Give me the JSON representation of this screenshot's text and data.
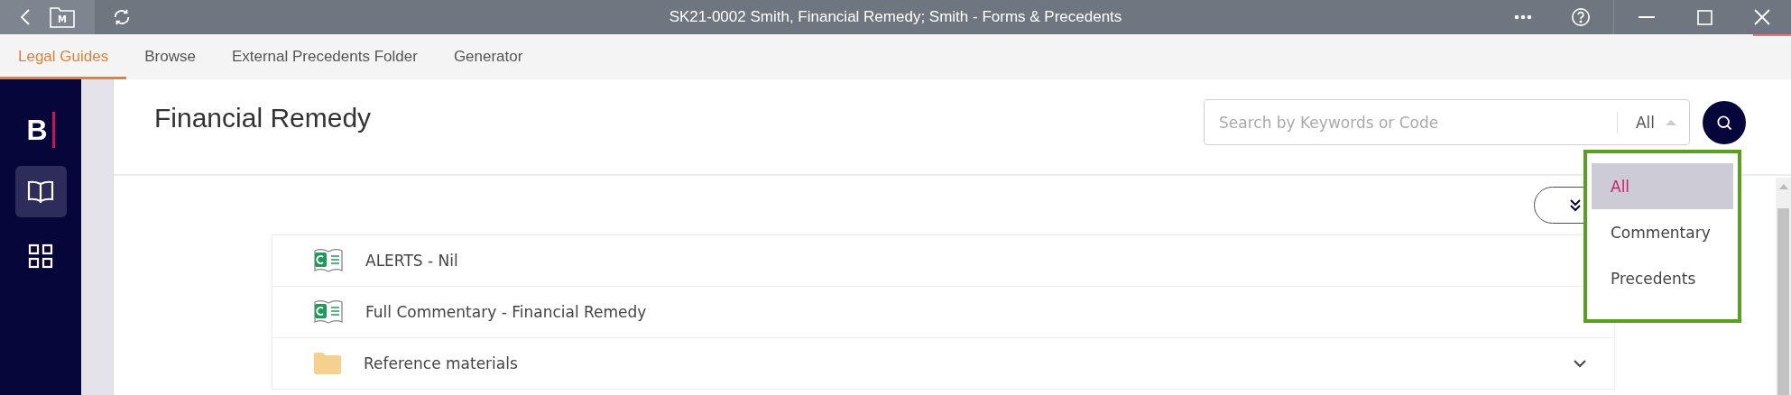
{
  "window": {
    "title": "SK21-0002 Smith, Financial Remedy; Smith - Forms & Precedents",
    "folder_badge": "M"
  },
  "tabs": [
    {
      "label": "Legal Guides",
      "selected": true
    },
    {
      "label": "Browse",
      "selected": false
    },
    {
      "label": "External Precedents Folder",
      "selected": false
    },
    {
      "label": "Generator",
      "selected": false
    }
  ],
  "sidebar": {
    "logo": "B",
    "items": [
      {
        "kind": "book",
        "selected": true
      },
      {
        "kind": "grid",
        "selected": false
      }
    ]
  },
  "page": {
    "title": "Financial Remedy"
  },
  "search": {
    "placeholder": "Search by Keywords or Code",
    "filter": "All",
    "filter_open": true
  },
  "filter_menu": [
    {
      "label": "All",
      "selected": true
    },
    {
      "label": "Commentary",
      "selected": false
    },
    {
      "label": "Precedents",
      "selected": false
    }
  ],
  "rows": [
    {
      "kind": "commentary",
      "label": "ALERTS - Nil"
    },
    {
      "kind": "commentary",
      "label": "Full Commentary - Financial Remedy"
    },
    {
      "kind": "folder",
      "label": "Reference materials",
      "expanded": false
    }
  ]
}
